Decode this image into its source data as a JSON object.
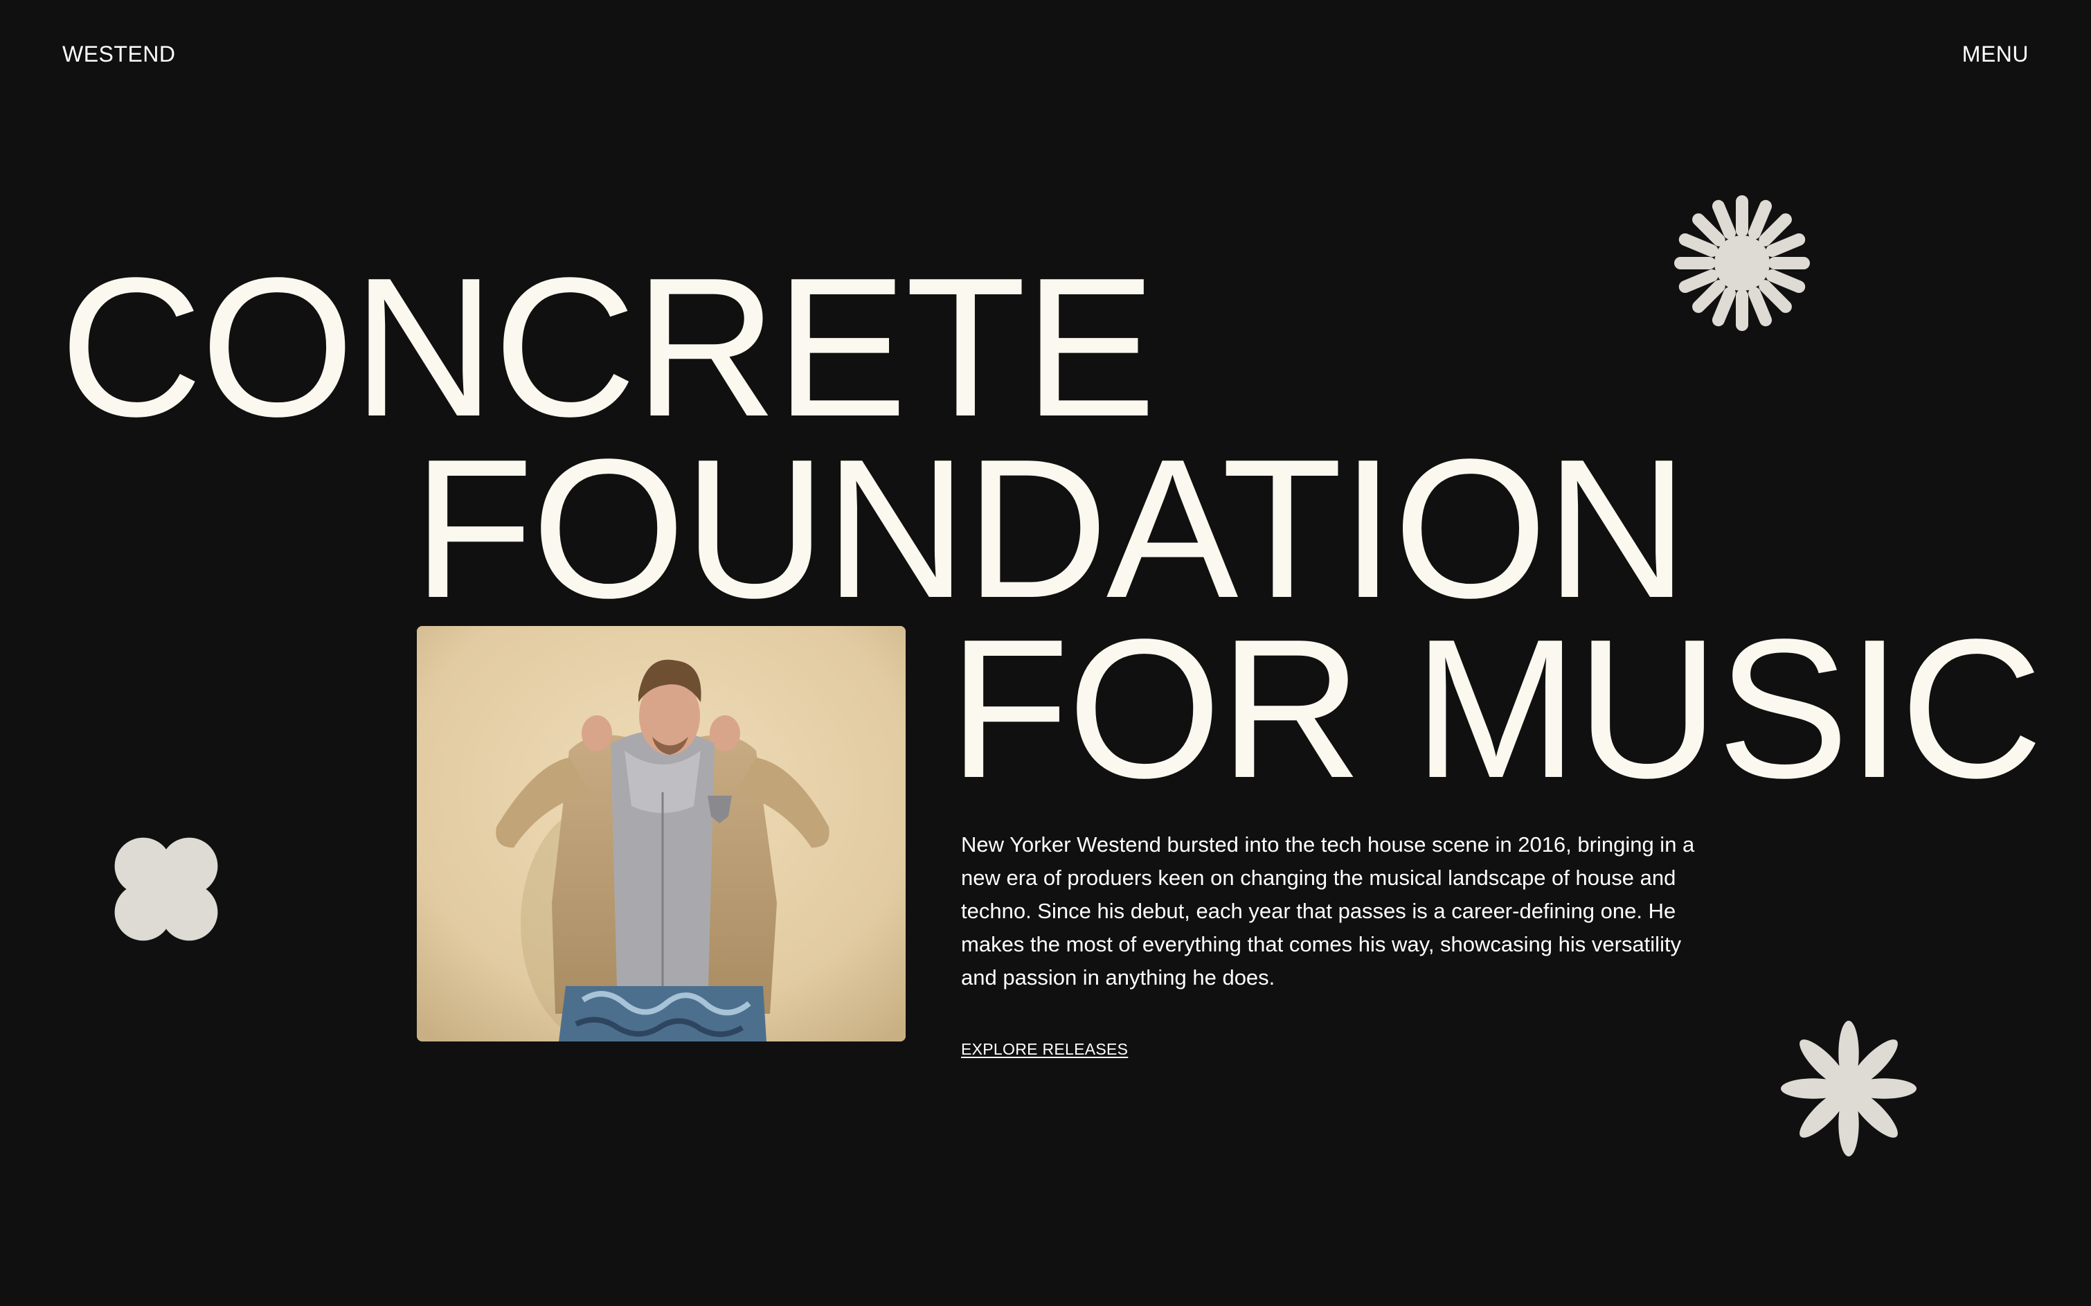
{
  "header": {
    "brand": "WESTEND",
    "menu_label": "MENU"
  },
  "hero": {
    "line_1": "CONCRETE",
    "line_2": "FOUNDATION",
    "line_3": "FOR MUSIC"
  },
  "about": {
    "bio": "New Yorker Westend bursted into the tech house scene in 2016, bringing in a new era of produers keen on changing the musical landscape of house and techno. Since his debut, each year that passes is a career-defining one. He makes the most of everything that comes his way, showcasing his versatility and passion in anything he does.",
    "cta_label": "EXPLORE RELEASES"
  },
  "decorations": {
    "sun": "sunburst-icon",
    "clover": "clover-icon",
    "flower": "flower-icon",
    "shape_color": "#dedad4"
  },
  "colors": {
    "background": "#101010",
    "text": "#fbf8ef",
    "photo_backdrop": "#e3cfa8"
  }
}
